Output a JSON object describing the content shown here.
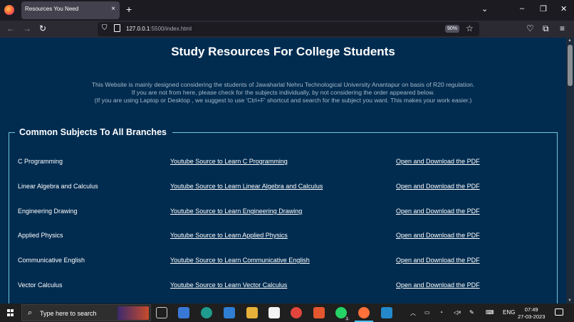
{
  "browser": {
    "tab_title": "Resources You Need",
    "tab_close": "×",
    "new_tab": "+",
    "url_host": "127.0.0.1",
    "url_path": ":5500/index.html",
    "zoom": "90%"
  },
  "page": {
    "title": "Study Resources For College Students",
    "intro": [
      "This Website is mainly designed considering the students of Jawaharlal Nehru Technological University Anantapur on basis of R20 regulation.",
      "If you are not from here, please check for the subjects individually, by not considering the order appeared below.",
      "(If you are using Laptop or Desktop , we suggest to use 'Ctrl+F' shortcut and search for the subject you want. This makes your work easier.)"
    ],
    "section_title": "Common Subjects To All Branches",
    "subjects": [
      {
        "name": "C Programming",
        "youtube": "Youtube Source to Learn C Programming",
        "pdf": "Open and Download the PDF"
      },
      {
        "name": "Linear Algebra and Calculus",
        "youtube": "Youtube Source to Learn Linear Algebra and Calculus",
        "pdf": "Open and Download the PDF"
      },
      {
        "name": "Engineering Drawing",
        "youtube": "Youtube Source to Learn Engineering Drawing",
        "pdf": "Open and Download the PDF"
      },
      {
        "name": "Applied Physics",
        "youtube": "Youtube Source to Learn Applied Physics",
        "pdf": "Open and Download the PDF"
      },
      {
        "name": "Communicative English",
        "youtube": "Youtube Source to Learn Communicative English",
        "pdf": "Open and Download the PDF"
      },
      {
        "name": "Vector Calculus",
        "youtube": "Youtube Source to Learn Vector Calculus",
        "pdf": "Open and Download the PDF"
      }
    ]
  },
  "taskbar": {
    "search_placeholder": "Type here to search",
    "language": "ENG",
    "time": "07:49",
    "date": "27-03-2023",
    "whatsapp_badge": "1"
  },
  "colors": {
    "page_bg": "#012c50",
    "fieldset_border": "#72c6e0",
    "intro_text": "#a6b9c9"
  }
}
